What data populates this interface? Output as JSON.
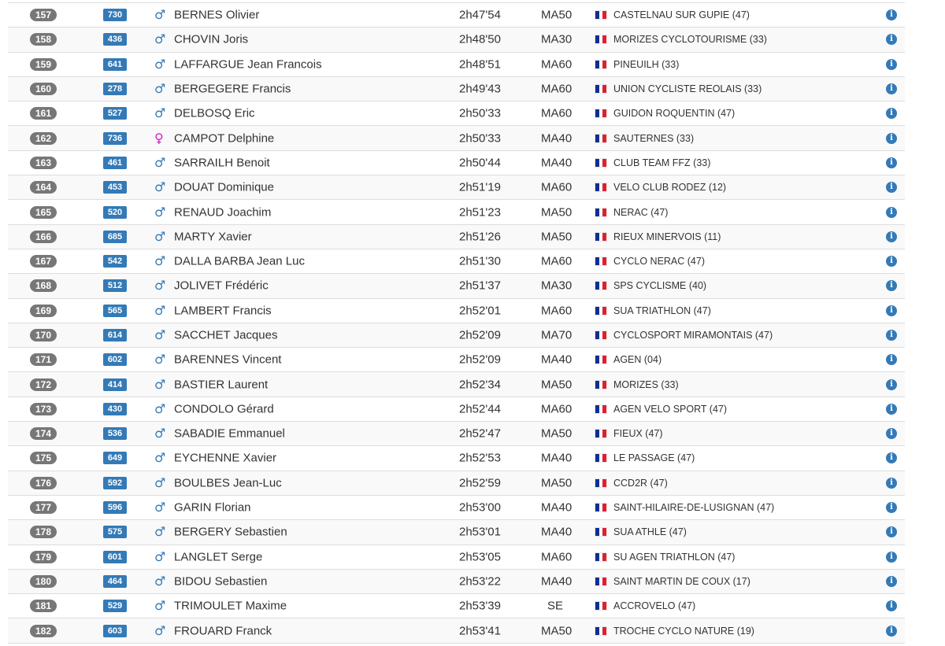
{
  "colors": {
    "rank_badge": "#777777",
    "bib_badge": "#337ab7",
    "male_symbol": "#337ab7",
    "female_symbol": "#d41ec4",
    "info_icon": "#337ab7",
    "row_stripe": "#f9f9f9"
  },
  "icons": {
    "male": "male-sign-icon",
    "female": "female-sign-icon",
    "flag": "france-flag-icon",
    "info": "info-circle-icon"
  },
  "results": [
    {
      "rank": "157",
      "bib": "730",
      "sex": "M",
      "sex_symbol": "♂",
      "name": "BERNES Olivier",
      "time": "2h47'54",
      "category": "MA50",
      "club": "CASTELNAU SUR GUPIE (47)"
    },
    {
      "rank": "158",
      "bib": "436",
      "sex": "M",
      "sex_symbol": "♂",
      "name": "CHOVIN Joris",
      "time": "2h48'50",
      "category": "MA30",
      "club": "MORIZES CYCLOTOURISME (33)"
    },
    {
      "rank": "159",
      "bib": "641",
      "sex": "M",
      "sex_symbol": "♂",
      "name": "LAFFARGUE Jean Francois",
      "time": "2h48'51",
      "category": "MA60",
      "club": "PINEUILH (33)"
    },
    {
      "rank": "160",
      "bib": "278",
      "sex": "M",
      "sex_symbol": "♂",
      "name": "BERGEGERE Francis",
      "time": "2h49'43",
      "category": "MA60",
      "club": "UNION CYCLISTE REOLAIS (33)"
    },
    {
      "rank": "161",
      "bib": "527",
      "sex": "M",
      "sex_symbol": "♂",
      "name": "DELBOSQ Eric",
      "time": "2h50'33",
      "category": "MA60",
      "club": "GUIDON ROQUENTIN (47)"
    },
    {
      "rank": "162",
      "bib": "736",
      "sex": "F",
      "sex_symbol": "♀",
      "name": "CAMPOT Delphine",
      "time": "2h50'33",
      "category": "MA40",
      "club": "SAUTERNES (33)"
    },
    {
      "rank": "163",
      "bib": "461",
      "sex": "M",
      "sex_symbol": "♂",
      "name": "SARRAILH Benoit",
      "time": "2h50'44",
      "category": "MA40",
      "club": "CLUB TEAM FFZ (33)"
    },
    {
      "rank": "164",
      "bib": "453",
      "sex": "M",
      "sex_symbol": "♂",
      "name": "DOUAT Dominique",
      "time": "2h51'19",
      "category": "MA60",
      "club": "VELO CLUB RODEZ (12)"
    },
    {
      "rank": "165",
      "bib": "520",
      "sex": "M",
      "sex_symbol": "♂",
      "name": "RENAUD Joachim",
      "time": "2h51'23",
      "category": "MA50",
      "club": "NERAC (47)"
    },
    {
      "rank": "166",
      "bib": "685",
      "sex": "M",
      "sex_symbol": "♂",
      "name": "MARTY Xavier",
      "time": "2h51'26",
      "category": "MA50",
      "club": "RIEUX MINERVOIS (11)"
    },
    {
      "rank": "167",
      "bib": "542",
      "sex": "M",
      "sex_symbol": "♂",
      "name": "DALLA BARBA Jean Luc",
      "time": "2h51'30",
      "category": "MA60",
      "club": "CYCLO NERAC (47)"
    },
    {
      "rank": "168",
      "bib": "512",
      "sex": "M",
      "sex_symbol": "♂",
      "name": "JOLIVET Frédéric",
      "time": "2h51'37",
      "category": "MA30",
      "club": "SPS CYCLISME (40)"
    },
    {
      "rank": "169",
      "bib": "565",
      "sex": "M",
      "sex_symbol": "♂",
      "name": "LAMBERT Francis",
      "time": "2h52'01",
      "category": "MA60",
      "club": "SUA TRIATHLON (47)"
    },
    {
      "rank": "170",
      "bib": "614",
      "sex": "M",
      "sex_symbol": "♂",
      "name": "SACCHET Jacques",
      "time": "2h52'09",
      "category": "MA70",
      "club": "CYCLOSPORT MIRAMONTAIS (47)"
    },
    {
      "rank": "171",
      "bib": "602",
      "sex": "M",
      "sex_symbol": "♂",
      "name": "BARENNES Vincent",
      "time": "2h52'09",
      "category": "MA40",
      "club": "AGEN (04)"
    },
    {
      "rank": "172",
      "bib": "414",
      "sex": "M",
      "sex_symbol": "♂",
      "name": "BASTIER Laurent",
      "time": "2h52'34",
      "category": "MA50",
      "club": "MORIZES (33)"
    },
    {
      "rank": "173",
      "bib": "430",
      "sex": "M",
      "sex_symbol": "♂",
      "name": "CONDOLO Gérard",
      "time": "2h52'44",
      "category": "MA60",
      "club": "AGEN VELO SPORT (47)"
    },
    {
      "rank": "174",
      "bib": "536",
      "sex": "M",
      "sex_symbol": "♂",
      "name": "SABADIE Emmanuel",
      "time": "2h52'47",
      "category": "MA50",
      "club": "FIEUX (47)"
    },
    {
      "rank": "175",
      "bib": "649",
      "sex": "M",
      "sex_symbol": "♂",
      "name": "EYCHENNE Xavier",
      "time": "2h52'53",
      "category": "MA40",
      "club": "LE PASSAGE (47)"
    },
    {
      "rank": "176",
      "bib": "592",
      "sex": "M",
      "sex_symbol": "♂",
      "name": "BOULBES Jean-Luc",
      "time": "2h52'59",
      "category": "MA50",
      "club": "CCD2R (47)"
    },
    {
      "rank": "177",
      "bib": "596",
      "sex": "M",
      "sex_symbol": "♂",
      "name": "GARIN Florian",
      "time": "2h53'00",
      "category": "MA40",
      "club": "SAINT-HILAIRE-DE-LUSIGNAN (47)"
    },
    {
      "rank": "178",
      "bib": "575",
      "sex": "M",
      "sex_symbol": "♂",
      "name": "BERGERY Sebastien",
      "time": "2h53'01",
      "category": "MA40",
      "club": "SUA ATHLE (47)"
    },
    {
      "rank": "179",
      "bib": "601",
      "sex": "M",
      "sex_symbol": "♂",
      "name": "LANGLET Serge",
      "time": "2h53'05",
      "category": "MA60",
      "club": "SU AGEN TRIATHLON (47)"
    },
    {
      "rank": "180",
      "bib": "464",
      "sex": "M",
      "sex_symbol": "♂",
      "name": "BIDOU Sebastien",
      "time": "2h53'22",
      "category": "MA40",
      "club": "SAINT MARTIN DE COUX (17)"
    },
    {
      "rank": "181",
      "bib": "529",
      "sex": "M",
      "sex_symbol": "♂",
      "name": "TRIMOULET Maxime",
      "time": "2h53'39",
      "category": "SE",
      "club": "ACCROVELO (47)"
    },
    {
      "rank": "182",
      "bib": "603",
      "sex": "M",
      "sex_symbol": "♂",
      "name": "FROUARD Franck",
      "time": "2h53'41",
      "category": "MA50",
      "club": "TROCHE CYCLO NATURE (19)"
    }
  ]
}
